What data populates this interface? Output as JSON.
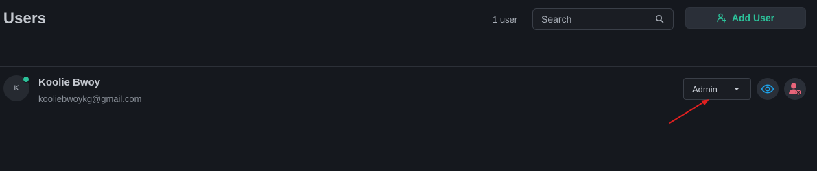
{
  "header": {
    "title": "Users",
    "user_count": "1 user",
    "search": {
      "placeholder": "Search",
      "value": ""
    },
    "add_user_label": "Add User"
  },
  "users": [
    {
      "initial": "K",
      "name": "Koolie Bwoy",
      "email": "kooliebwoykg@gmail.com",
      "online": true,
      "role": "Admin"
    }
  ],
  "icons": {
    "search": "search-icon",
    "add_user": "user-plus-icon",
    "view": "eye-icon",
    "remove": "user-remove-icon",
    "role_dropdown": "caret-down-icon"
  },
  "colors": {
    "background": "#15181e",
    "accent": "#2cc29a",
    "view_icon": "#1da1e8",
    "remove_icon": "#e8657a",
    "annotation_arrow": "#e02020"
  }
}
